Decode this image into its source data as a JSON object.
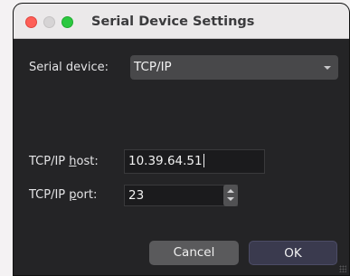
{
  "window": {
    "title": "Serial Device Settings"
  },
  "serial_device": {
    "label": "Serial device:",
    "selected": "TCP/IP"
  },
  "tcp_host": {
    "label_pre": "TCP/IP ",
    "label_accel": "h",
    "label_post": "ost:",
    "value": "10.39.64.51"
  },
  "tcp_port": {
    "label_pre": "TCP/IP ",
    "label_accel": "p",
    "label_post": "ort:",
    "value": "23"
  },
  "buttons": {
    "cancel": "Cancel",
    "ok": "OK"
  },
  "colors": {
    "background": "#242426",
    "titlebar": "#ebe9ea",
    "close": "#fe5f57",
    "zoom": "#2bc840",
    "button_cancel": "#5a5a5c",
    "button_ok": "#3a3a4e"
  },
  "icons": {
    "dropdown": "chevron-down-icon",
    "stepper_up": "arrow-up-icon",
    "stepper_down": "arrow-down-icon",
    "resize": "resize-grip-icon"
  }
}
